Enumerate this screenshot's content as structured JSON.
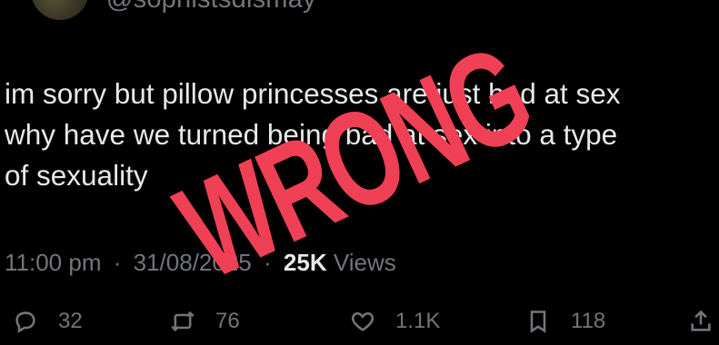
{
  "tweet": {
    "handle": "@sophistsdismay",
    "text_lines": [
      "im sorry but pillow princesses are just bad at sex",
      "why have we turned being bad at sex into a type",
      "of sexuality"
    ],
    "time": "11:00 pm",
    "date": "31/08/2025",
    "separator": "·",
    "views_count": "25K",
    "views_label": "Views"
  },
  "stamp": {
    "text": "WRONG",
    "color": "#ef4056"
  },
  "actions": [
    {
      "icon": "reply-icon",
      "count": "32"
    },
    {
      "icon": "repost-icon",
      "count": "76"
    },
    {
      "icon": "like-icon",
      "count": "1.1K"
    },
    {
      "icon": "bookmark-icon",
      "count": "118"
    },
    {
      "icon": "share-icon",
      "count": ""
    }
  ]
}
